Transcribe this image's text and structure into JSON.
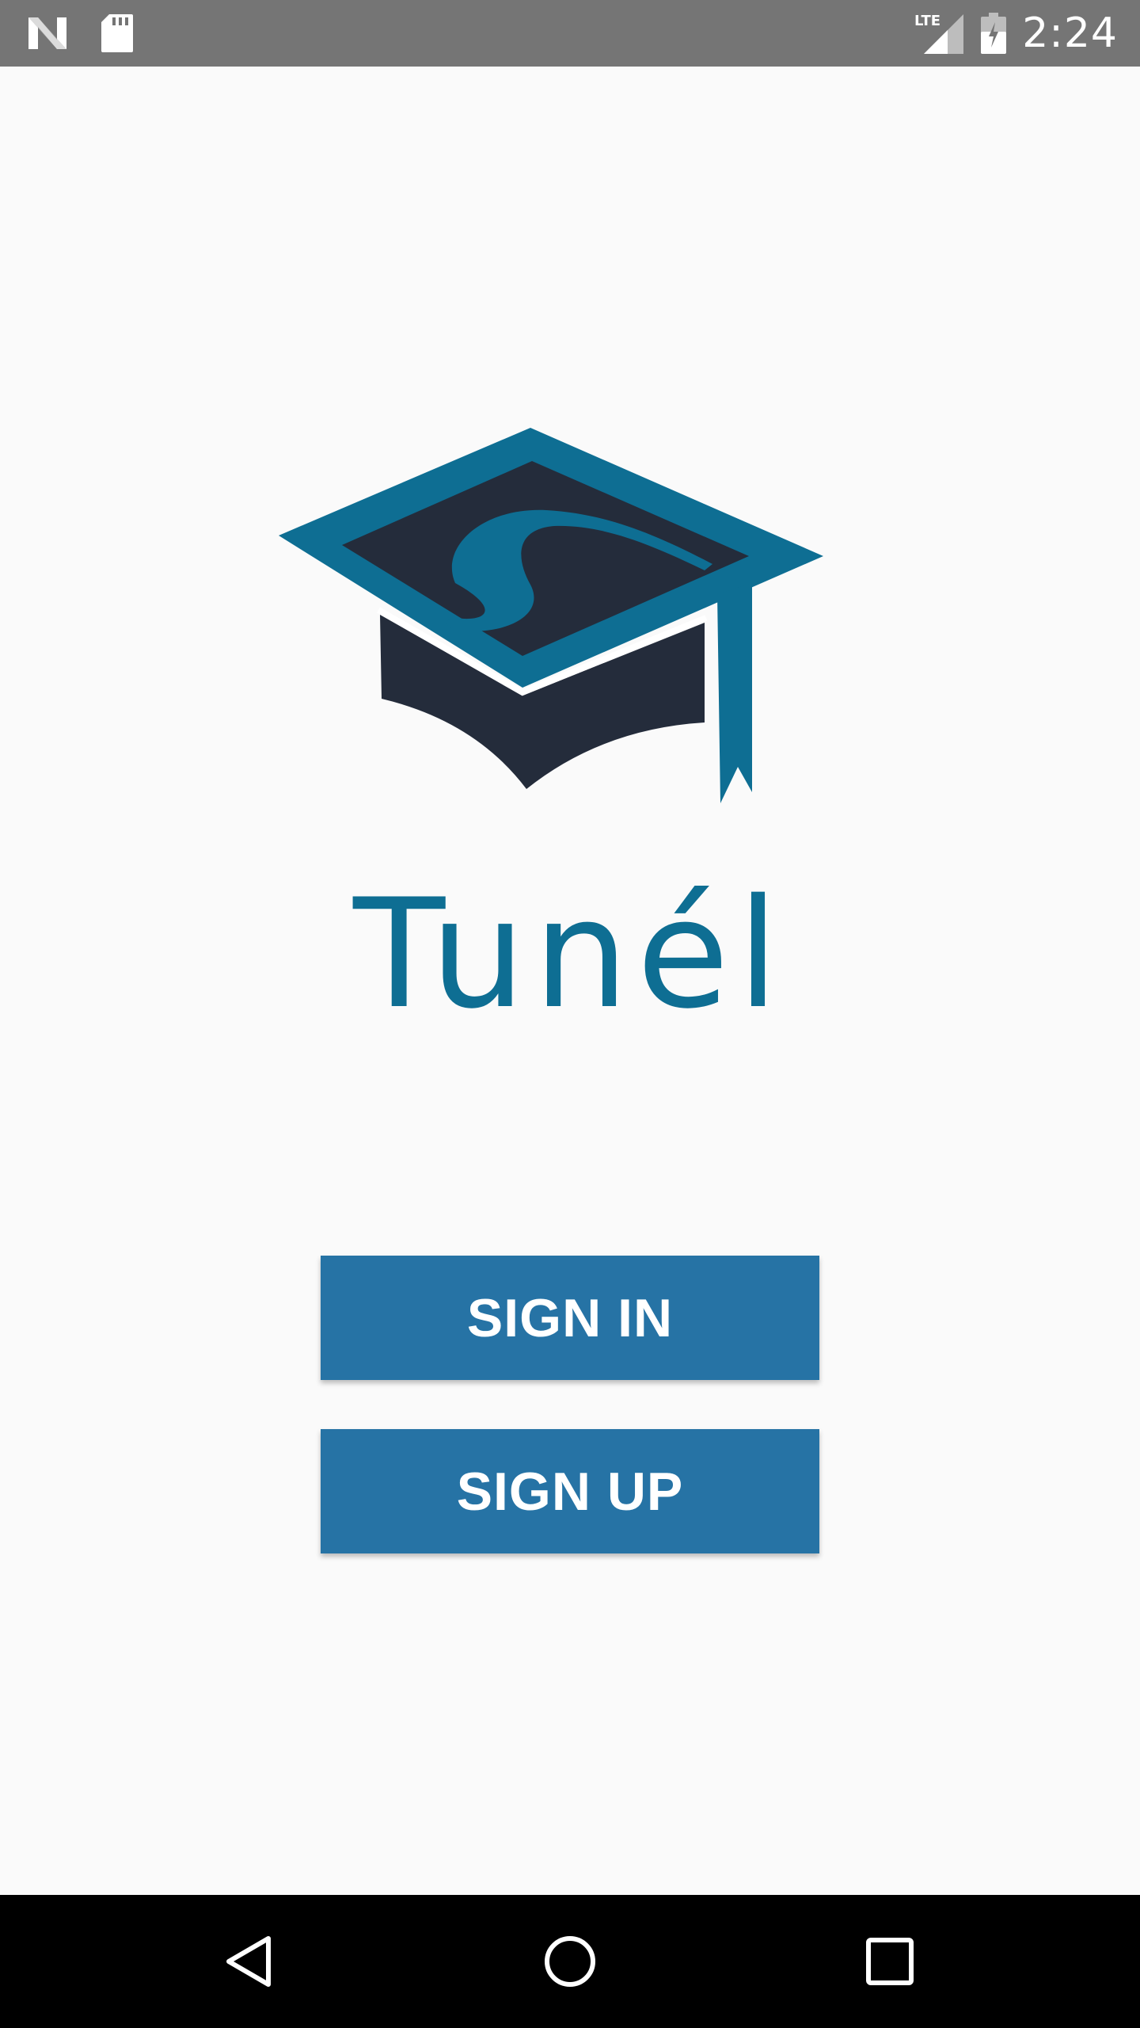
{
  "status_bar": {
    "time": "2:24",
    "network": "LTE",
    "icons": [
      "n-notification-icon",
      "sd-card-icon",
      "lte-signal-icon",
      "battery-icon"
    ]
  },
  "brand": {
    "name": "Tunél",
    "logo_icon": "graduation-cap-icon",
    "colors": {
      "primary": "#0e6e93",
      "dark": "#242c3b",
      "button": "#2673a5"
    }
  },
  "actions": {
    "sign_in_label": "SIGN IN",
    "sign_up_label": "SIGN UP"
  },
  "navigation": {
    "icons": [
      "back-icon",
      "home-icon",
      "recents-icon"
    ]
  }
}
